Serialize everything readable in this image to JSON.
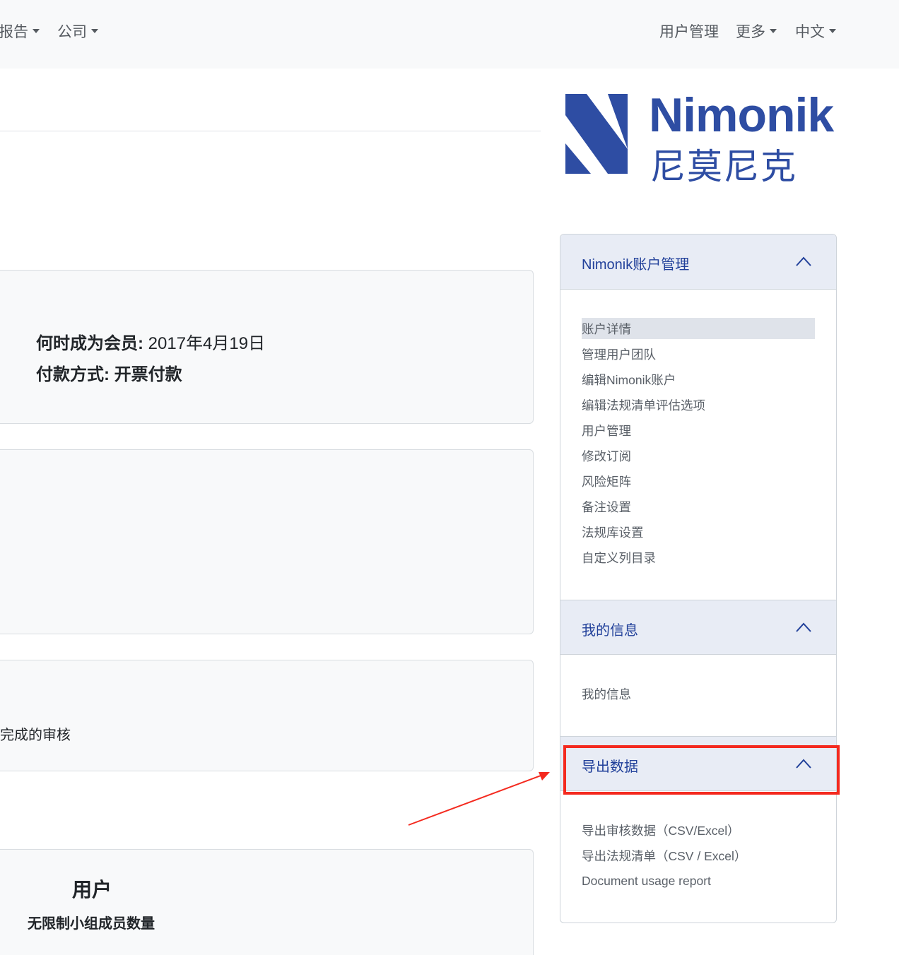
{
  "navbar": {
    "left_items": [
      {
        "label": "报告",
        "icon": "caret-down-icon"
      },
      {
        "label": "公司",
        "icon": "caret-down-icon"
      }
    ],
    "right_items": [
      {
        "label": "用户管理"
      },
      {
        "label": "更多",
        "icon": "caret-down-icon"
      },
      {
        "label": "中文",
        "icon": "caret-down-icon"
      }
    ]
  },
  "membership": {
    "member_since_label": "何时成为会员:",
    "member_since_value": "2017年4月19日",
    "payment_label": "付款方式:",
    "payment_value": "开票付款"
  },
  "audits": {
    "text": "完成的审核"
  },
  "users": {
    "title": "用户",
    "subtitle": "无限制小组成员数量"
  },
  "logo": {
    "name_en": "Nimonik",
    "name_cn": "尼莫尼克"
  },
  "sidebar": {
    "sections": [
      {
        "title": "Nimonik账户管理",
        "icon": "chevron-up-icon",
        "links": [
          "账户详情",
          "管理用户团队",
          "编辑Nimonik账户",
          "编辑法规清单评估选项",
          "用户管理",
          "修改订阅",
          "风险矩阵",
          "备注设置",
          "法规库设置",
          "自定义列目录"
        ],
        "active": "账户详情"
      },
      {
        "title": "我的信息",
        "icon": "chevron-up-icon",
        "links": [
          "我的信息"
        ]
      },
      {
        "title": "导出数据",
        "icon": "chevron-up-icon",
        "links": [
          "导出审核数据（CSV/Excel）",
          "导出法规清单（CSV / Excel）",
          "Document usage report"
        ]
      }
    ]
  },
  "colors": {
    "brand": "#2e4da3",
    "accordion_header": "#e8ecf5",
    "highlight": "#f42a1f"
  }
}
